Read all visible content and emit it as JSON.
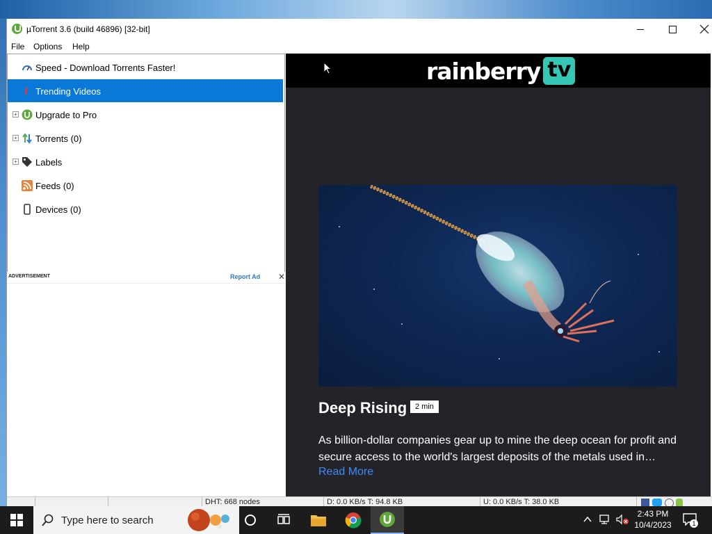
{
  "window": {
    "title": "µTorrent 3.6  (build 46896) [32-bit]"
  },
  "menu": [
    "File",
    "Options",
    "Help"
  ],
  "sidebar": {
    "items": [
      {
        "label": "Speed - Download Torrents Faster!",
        "icon": "speedometer-icon",
        "expandable": false,
        "selected": false
      },
      {
        "label": "Trending Videos",
        "icon": "flame-icon",
        "expandable": false,
        "selected": true
      },
      {
        "label": "Upgrade to Pro",
        "icon": "utorrent-icon",
        "expandable": true,
        "selected": false
      },
      {
        "label": "Torrents (0)",
        "icon": "updown-arrows-icon",
        "expandable": true,
        "selected": false
      },
      {
        "label": "Labels",
        "icon": "tag-icon",
        "expandable": true,
        "selected": false
      },
      {
        "label": "Feeds (0)",
        "icon": "rss-icon",
        "expandable": false,
        "selected": false
      },
      {
        "label": "Devices (0)",
        "icon": "phone-icon",
        "expandable": false,
        "selected": false
      }
    ]
  },
  "ad": {
    "label": "ADVERTISEMENT",
    "report": "Report Ad",
    "close": "✕"
  },
  "content": {
    "brand_word": "rainberry",
    "brand_tv": "tv",
    "video": {
      "title": "Deep Rising",
      "duration": "2 min",
      "description": "As billion-dollar companies gear up to mine the deep ocean for profit and secure access to the world's largest deposits of the metals used in…",
      "read_more": "Read More"
    }
  },
  "status": {
    "dht": "DHT: 668 nodes",
    "down": "D: 0.0 KB/s T: 94.8 KB",
    "up": "U: 0.0 KB/s T: 38.0 KB"
  },
  "taskbar": {
    "search_placeholder": "Type here to search",
    "time": "2:43 PM",
    "date": "10/4/2023",
    "notification_count": "1"
  },
  "colors": {
    "selected": "#0a78d7",
    "content_bg": "#24232a",
    "brand_tv": "#35c7b4",
    "link": "#3d8af7"
  }
}
